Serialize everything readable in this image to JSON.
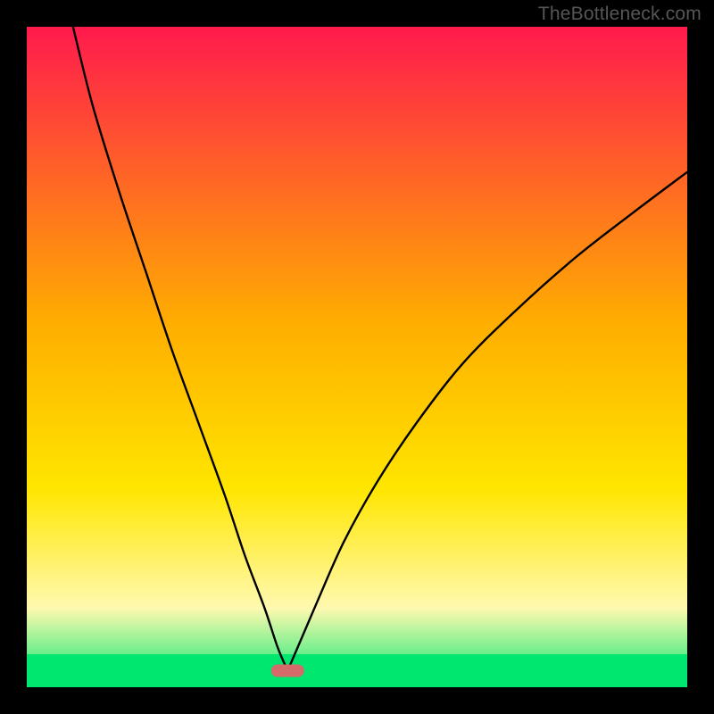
{
  "watermark": "TheBottleneck.com",
  "chart_data": {
    "type": "line",
    "title": "",
    "xlabel": "",
    "ylabel": "",
    "xlim": [
      0,
      100
    ],
    "ylim": [
      0,
      100
    ],
    "background_gradient": {
      "top": "#ff1a4d",
      "mid": "#ffd400",
      "bottom": "#00e770"
    },
    "green_band_y": [
      0,
      5
    ],
    "marker": {
      "x_range": [
        37,
        42
      ],
      "y": 2.5,
      "color": "#d56a6a",
      "shape": "pill"
    },
    "series": [
      {
        "name": "curve-left",
        "x": [
          7,
          10,
          14,
          18,
          22,
          26,
          30,
          33,
          36,
          38,
          39.5
        ],
        "y": [
          100,
          88,
          75,
          63,
          51,
          40,
          29,
          20,
          12,
          6,
          2.5
        ]
      },
      {
        "name": "curve-right",
        "x": [
          39.5,
          41,
          44,
          48,
          53,
          59,
          66,
          74,
          83,
          92,
          100
        ],
        "y": [
          2.5,
          6,
          13,
          22,
          31,
          40,
          49,
          57,
          65,
          72,
          78
        ]
      }
    ],
    "axis_visible": false,
    "grid": false
  }
}
